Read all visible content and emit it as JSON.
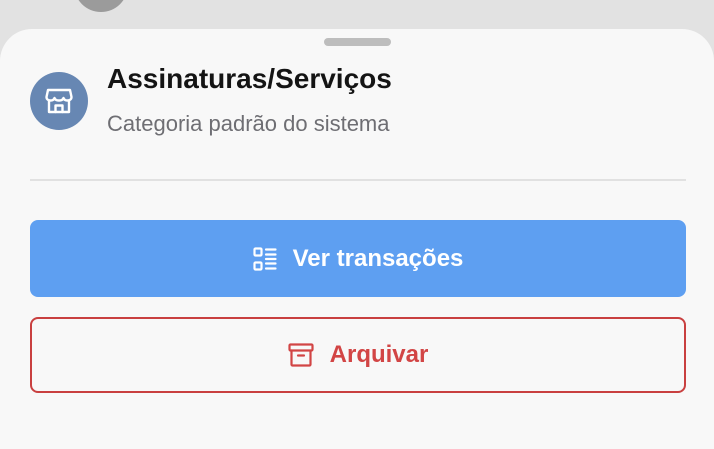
{
  "category": {
    "title": "Assinaturas/Serviços",
    "subtitle": "Categoria padrão do sistema",
    "icon": "store-icon",
    "icon_bg": "#6787b3"
  },
  "actions": {
    "view_transactions_label": "Ver transações",
    "view_transactions_icon": "list-icon",
    "archive_label": "Arquivar",
    "archive_icon": "archive-box-icon"
  },
  "colors": {
    "primary": "#5e9ff1",
    "danger": "#d24545"
  }
}
